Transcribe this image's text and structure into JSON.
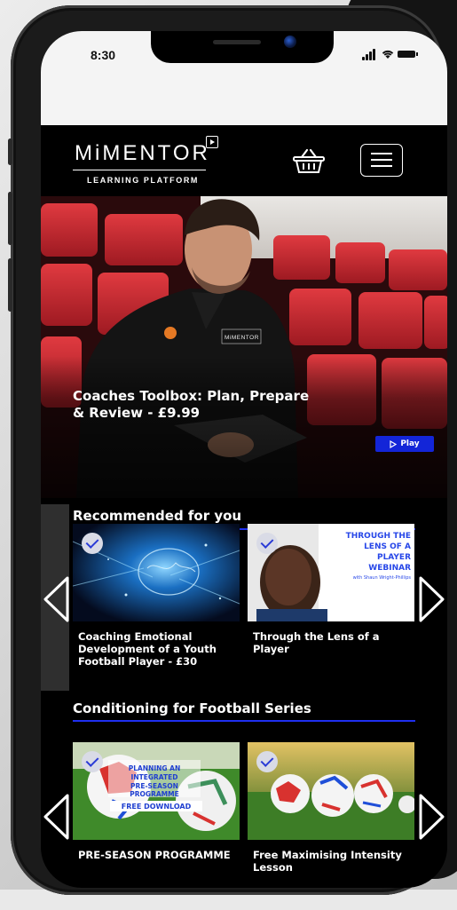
{
  "status_bar": {
    "time": "8:30"
  },
  "header": {
    "logo_text": "MiMENTOR",
    "logo_subtitle": "LEARNING PLATFORM",
    "basket_icon": "basket-icon",
    "menu_icon": "hamburger-menu-icon"
  },
  "hero": {
    "title": "Coaches Toolbox: Plan, Prepare & Review - £9.99",
    "play_label": "Play",
    "logo_patch": "MiMENTOR"
  },
  "sections": [
    {
      "title": "Recommended for you",
      "cards": [
        {
          "title": "Coaching Emotional Development of a Youth Football Player - £30"
        },
        {
          "title": "Through the Lens of a Player",
          "thumb_text": "THROUGH THE LENS OF A PLAYER WEBINAR",
          "thumb_caption": "with Shaun Wright-Phillips"
        }
      ]
    },
    {
      "title": "Conditioning for Football Series",
      "cards": [
        {
          "title": "PRE-SEASON PROGRAMME",
          "thumb_text": "PLANNING AN INTEGRATED PRE-SEASON PROGRAMME",
          "thumb_badge": "FREE DOWNLOAD"
        },
        {
          "title": "Free Maximising Intensity Lesson"
        }
      ]
    }
  ],
  "colors": {
    "accent_blue": "#1e2ff0",
    "play_blue": "#1325d8",
    "seat_red": "#c8232d",
    "background": "#000000"
  }
}
